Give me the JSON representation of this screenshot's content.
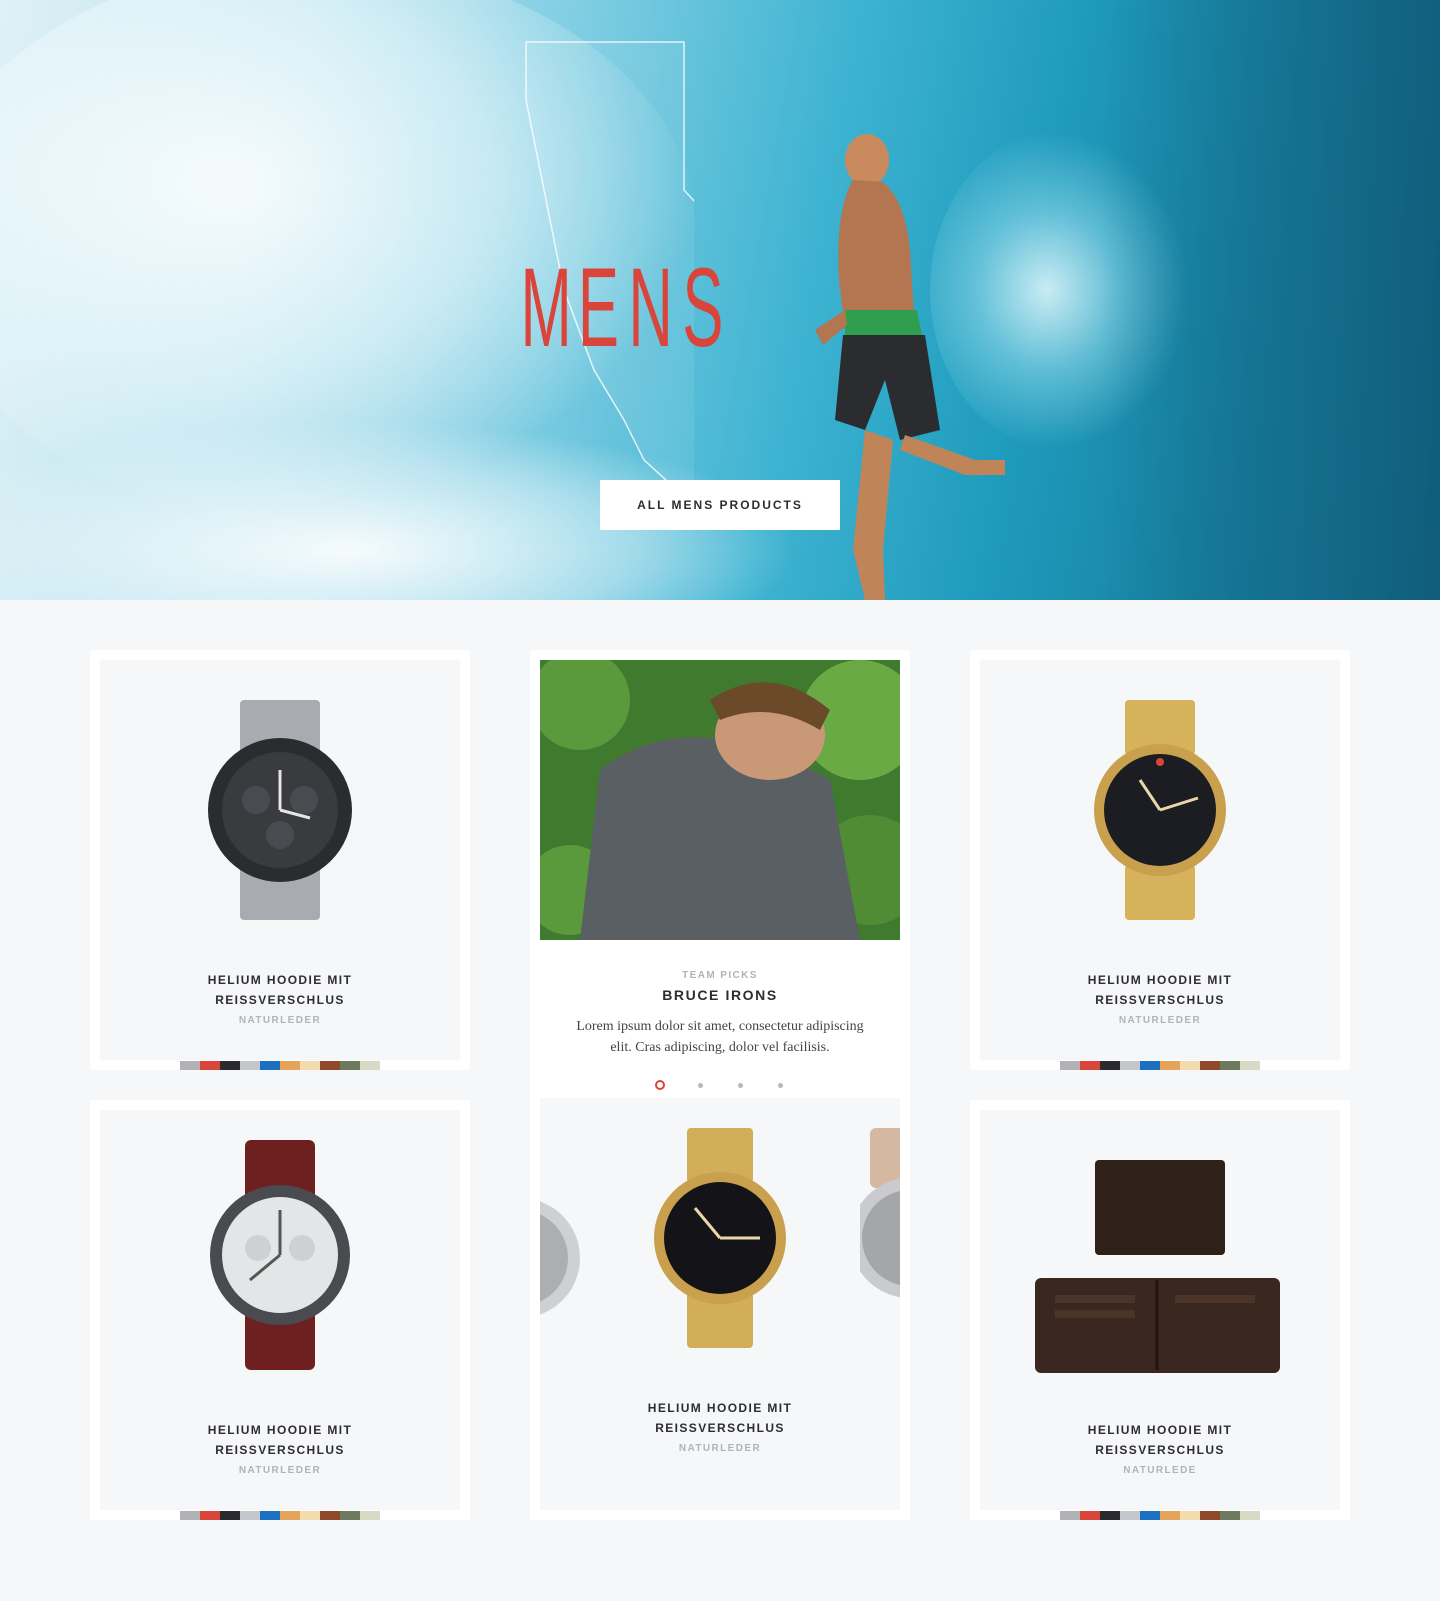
{
  "hero": {
    "title_letters": [
      "M",
      "E",
      "N",
      "S"
    ],
    "cta_label": "ALL MENS PRODUCTS"
  },
  "products": [
    {
      "title_line1": "HELIUM HOODIE MIT",
      "title_line2": "REISSVERSCHLUS",
      "material": "NATURLEDER",
      "image": "steel-chronograph-watch"
    },
    {
      "title_line1": "HELIUM HOODIE MIT",
      "title_line2": "REISSVERSCHLUS",
      "material": "NATURLEDER",
      "image": "gold-black-dial-watch"
    },
    {
      "title_line1": "HELIUM HOODIE MIT",
      "title_line2": "REISSVERSCHLUS",
      "material": "NATURLEDER",
      "image": "leather-strap-chronograph-watch"
    },
    {
      "title_line1": "HELIUM HOODIE MIT",
      "title_line2": "REISSVERSCHLUS",
      "material": "NATURLEDER",
      "image": "gold-sentry-watch"
    },
    {
      "title_line1": "HELIUM HOODIE MIT",
      "title_line2": "REISSVERSCHLUS",
      "material": "NATURLEDE",
      "image": "leather-wallet"
    }
  ],
  "feature": {
    "label": "TEAM PICKS",
    "name": "BRUCE IRONS",
    "description": "Lorem ipsum dolor sit amet, consectetur adipiscing elit. Cras adipiscing, dolor vel facilisis.",
    "carousel_active": 1,
    "carousel_count": 4
  },
  "swatch_colors": [
    "#b1b2b6",
    "#d9453b",
    "#2b2b2f",
    "#c4c6cb",
    "#1e6fbf",
    "#e5a35b",
    "#f2dcaf",
    "#8e4a2a",
    "#6e7a5e",
    "#d7dac4"
  ]
}
